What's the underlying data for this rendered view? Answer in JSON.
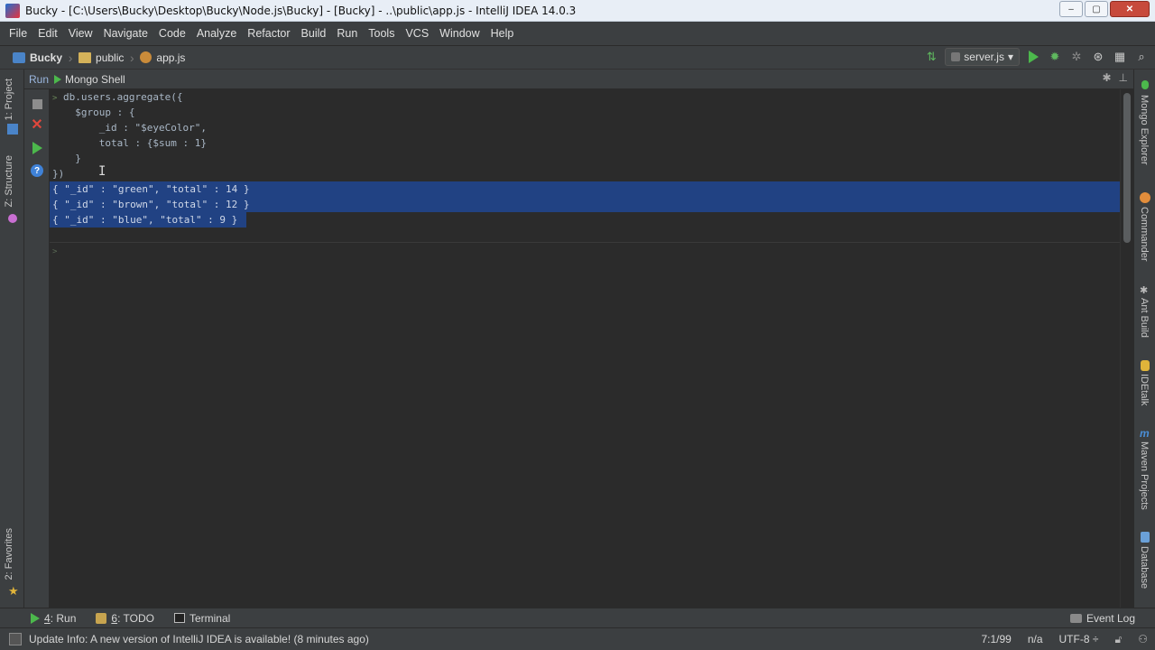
{
  "window": {
    "title": "Bucky - [C:\\Users\\Bucky\\Desktop\\Bucky\\Node.js\\Bucky] - [Bucky] - ..\\public\\app.js - IntelliJ IDEA 14.0.3",
    "minimize": "–",
    "maximize": "▢",
    "close": "✕"
  },
  "menu": [
    "File",
    "Edit",
    "View",
    "Navigate",
    "Code",
    "Analyze",
    "Refactor",
    "Build",
    "Run",
    "Tools",
    "VCS",
    "Window",
    "Help"
  ],
  "breadcrumb": [
    "Bucky",
    "public",
    "app.js"
  ],
  "toolbar": {
    "run_config": "server.js",
    "run_config_arrow": "▾"
  },
  "left_stripe": {
    "project": "1: Project",
    "structure": "Z: Structure",
    "favorites": "2: Favorites"
  },
  "right_stripe": {
    "mongo": "Mongo Explorer",
    "commander": "Commander",
    "ant": "Ant Build",
    "idetalk": "IDEtalk",
    "maven": "Maven Projects",
    "database": "Database"
  },
  "run_window": {
    "label": "Run",
    "tab": "Mongo Shell",
    "gear": "✱",
    "pin": "⊥"
  },
  "console": {
    "prompt": ">",
    "lines": [
      "db.users.aggregate({",
      "  $group : {",
      "      _id : \"$eyeColor\",",
      "      total : {$sum : 1}",
      "  }",
      "})"
    ],
    "results": [
      "{ \"_id\" : \"green\", \"total\" : 14 }",
      "{ \"_id\" : \"brown\", \"total\" : 12 }",
      "{ \"_id\" : \"blue\", \"total\" : 9 }"
    ]
  },
  "bottom_tabs": {
    "run_key": "4",
    "run": ": Run",
    "todo_key": "6",
    "todo": ": TODO",
    "terminal": "Terminal",
    "event_log": "Event Log"
  },
  "status": {
    "message": "Update Info: A new version of IntelliJ IDEA is available! (8 minutes ago)",
    "position": "7:1/99",
    "na": "n/a",
    "encoding": "UTF-8",
    "encoding_arrow": "÷"
  }
}
